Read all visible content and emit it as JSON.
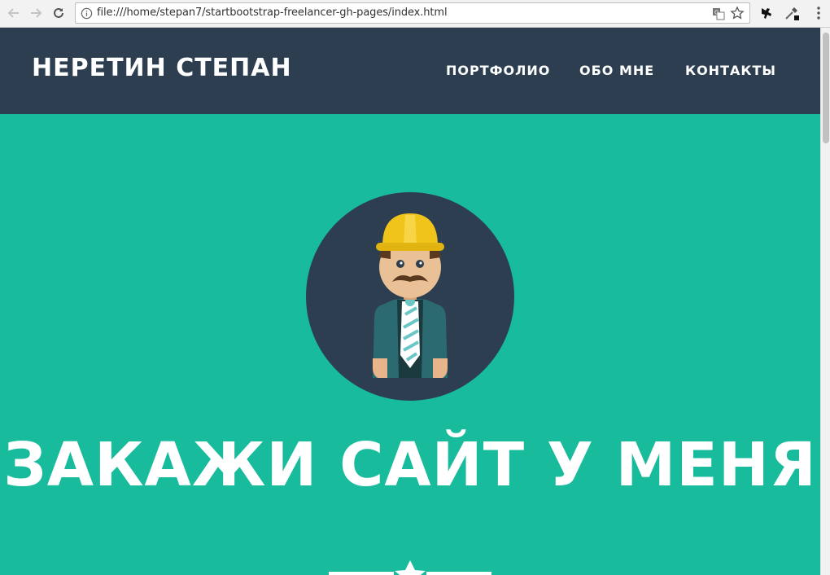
{
  "browser": {
    "url": "file:///home/stepan7/startbootstrap-freelancer-gh-pages/index.html",
    "icons": [
      "back-arrow-icon",
      "forward-arrow-icon",
      "reload-icon",
      "info-icon",
      "translate-icon",
      "star-icon",
      "extension-icon",
      "eyedropper-icon",
      "menu-icon"
    ]
  },
  "navbar": {
    "brand": "НЕРЕТИН СТЕПАН",
    "links": [
      "ПОРТФОЛИО",
      "ОБО МНЕ",
      "КОНТАКТЫ"
    ]
  },
  "header": {
    "headline": "ЗАКАЖИ САЙТ У МЕНЯ",
    "avatar_icon": "builder-avatar-icon",
    "divider_icon": "star-icon"
  },
  "colors": {
    "navbar_bg": "#2c3e50",
    "header_bg": "#18bc9c",
    "text": "#ffffff"
  }
}
